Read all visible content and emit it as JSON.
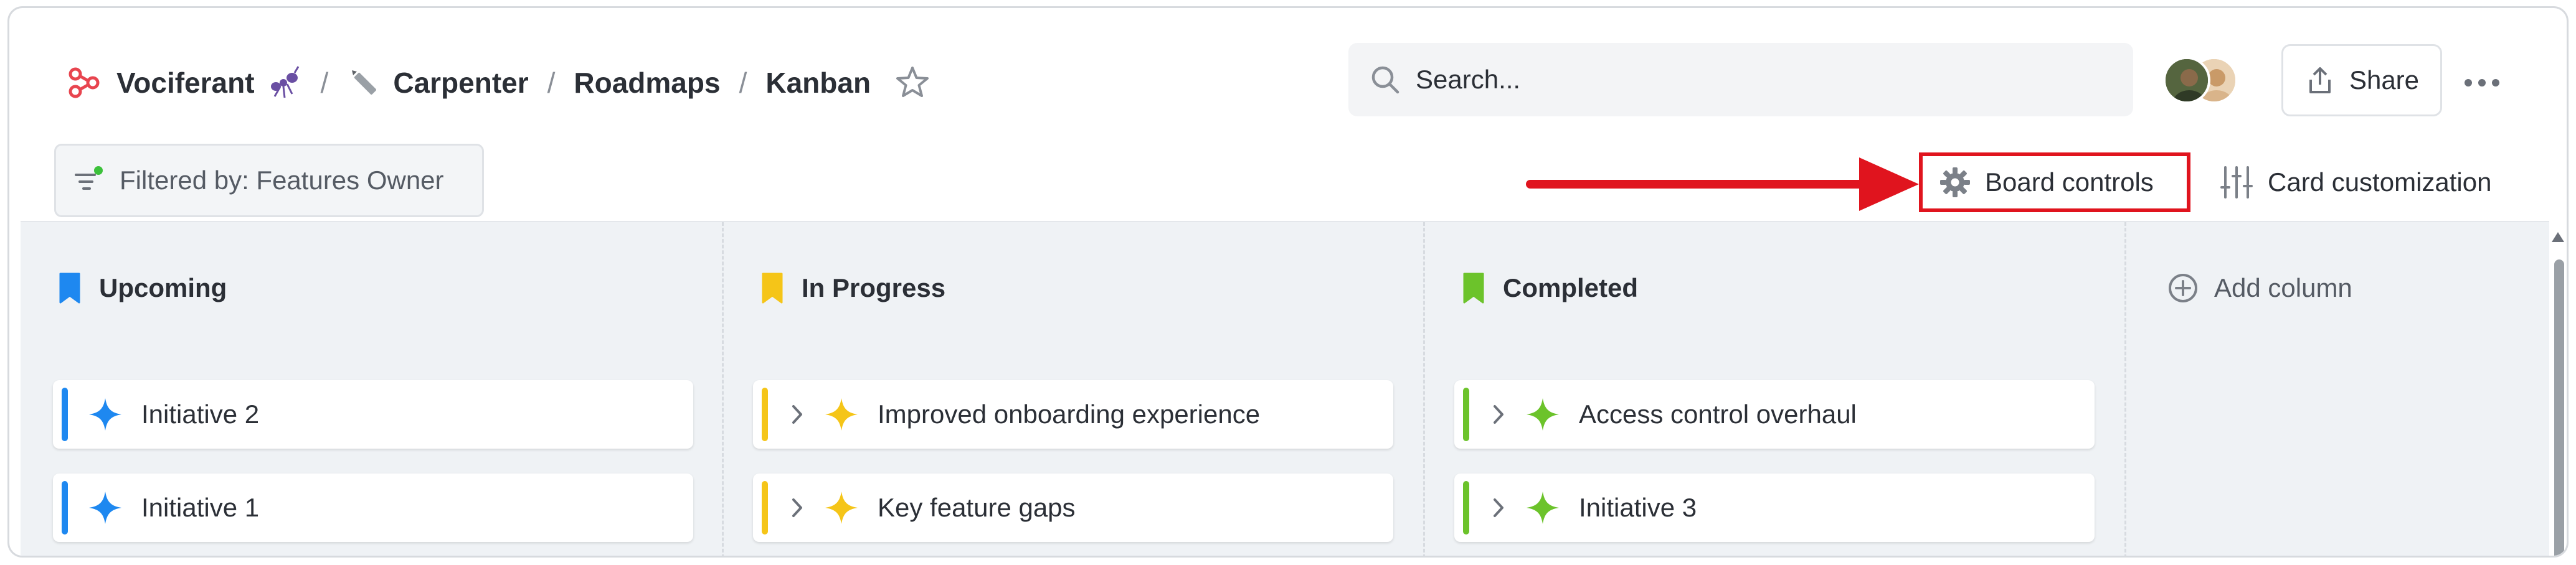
{
  "breadcrumb": {
    "items": [
      {
        "label": "Vociferant",
        "icon": "brand-icon"
      },
      {
        "label": "Carpenter",
        "icon": "pencil-icon"
      },
      {
        "label": "Roadmaps"
      },
      {
        "label": "Kanban"
      }
    ],
    "separator": "/"
  },
  "search": {
    "placeholder": "Search..."
  },
  "header": {
    "share_label": "Share"
  },
  "toolbar": {
    "filter_label": "Filtered by: Features Owner",
    "board_controls_label": "Board controls",
    "card_customization_label": "Card customization"
  },
  "columns": [
    {
      "title": "Upcoming",
      "color": "#1e88f0",
      "cards": [
        {
          "title": "Initiative 2",
          "expandable": false
        },
        {
          "title": "Initiative 1",
          "expandable": false
        }
      ]
    },
    {
      "title": "In Progress",
      "color": "#f5c518",
      "cards": [
        {
          "title": "Improved onboarding experience",
          "expandable": true
        },
        {
          "title": "Key feature gaps",
          "expandable": true
        }
      ]
    },
    {
      "title": "Completed",
      "color": "#6cc32b",
      "cards": [
        {
          "title": "Access control overhaul",
          "expandable": true
        },
        {
          "title": "Initiative 3",
          "expandable": true
        }
      ]
    }
  ],
  "add_column_label": "Add column",
  "colors": {
    "brand": "#e8454f",
    "highlight": "#e0141e",
    "filter_dot": "#3cc13b"
  }
}
